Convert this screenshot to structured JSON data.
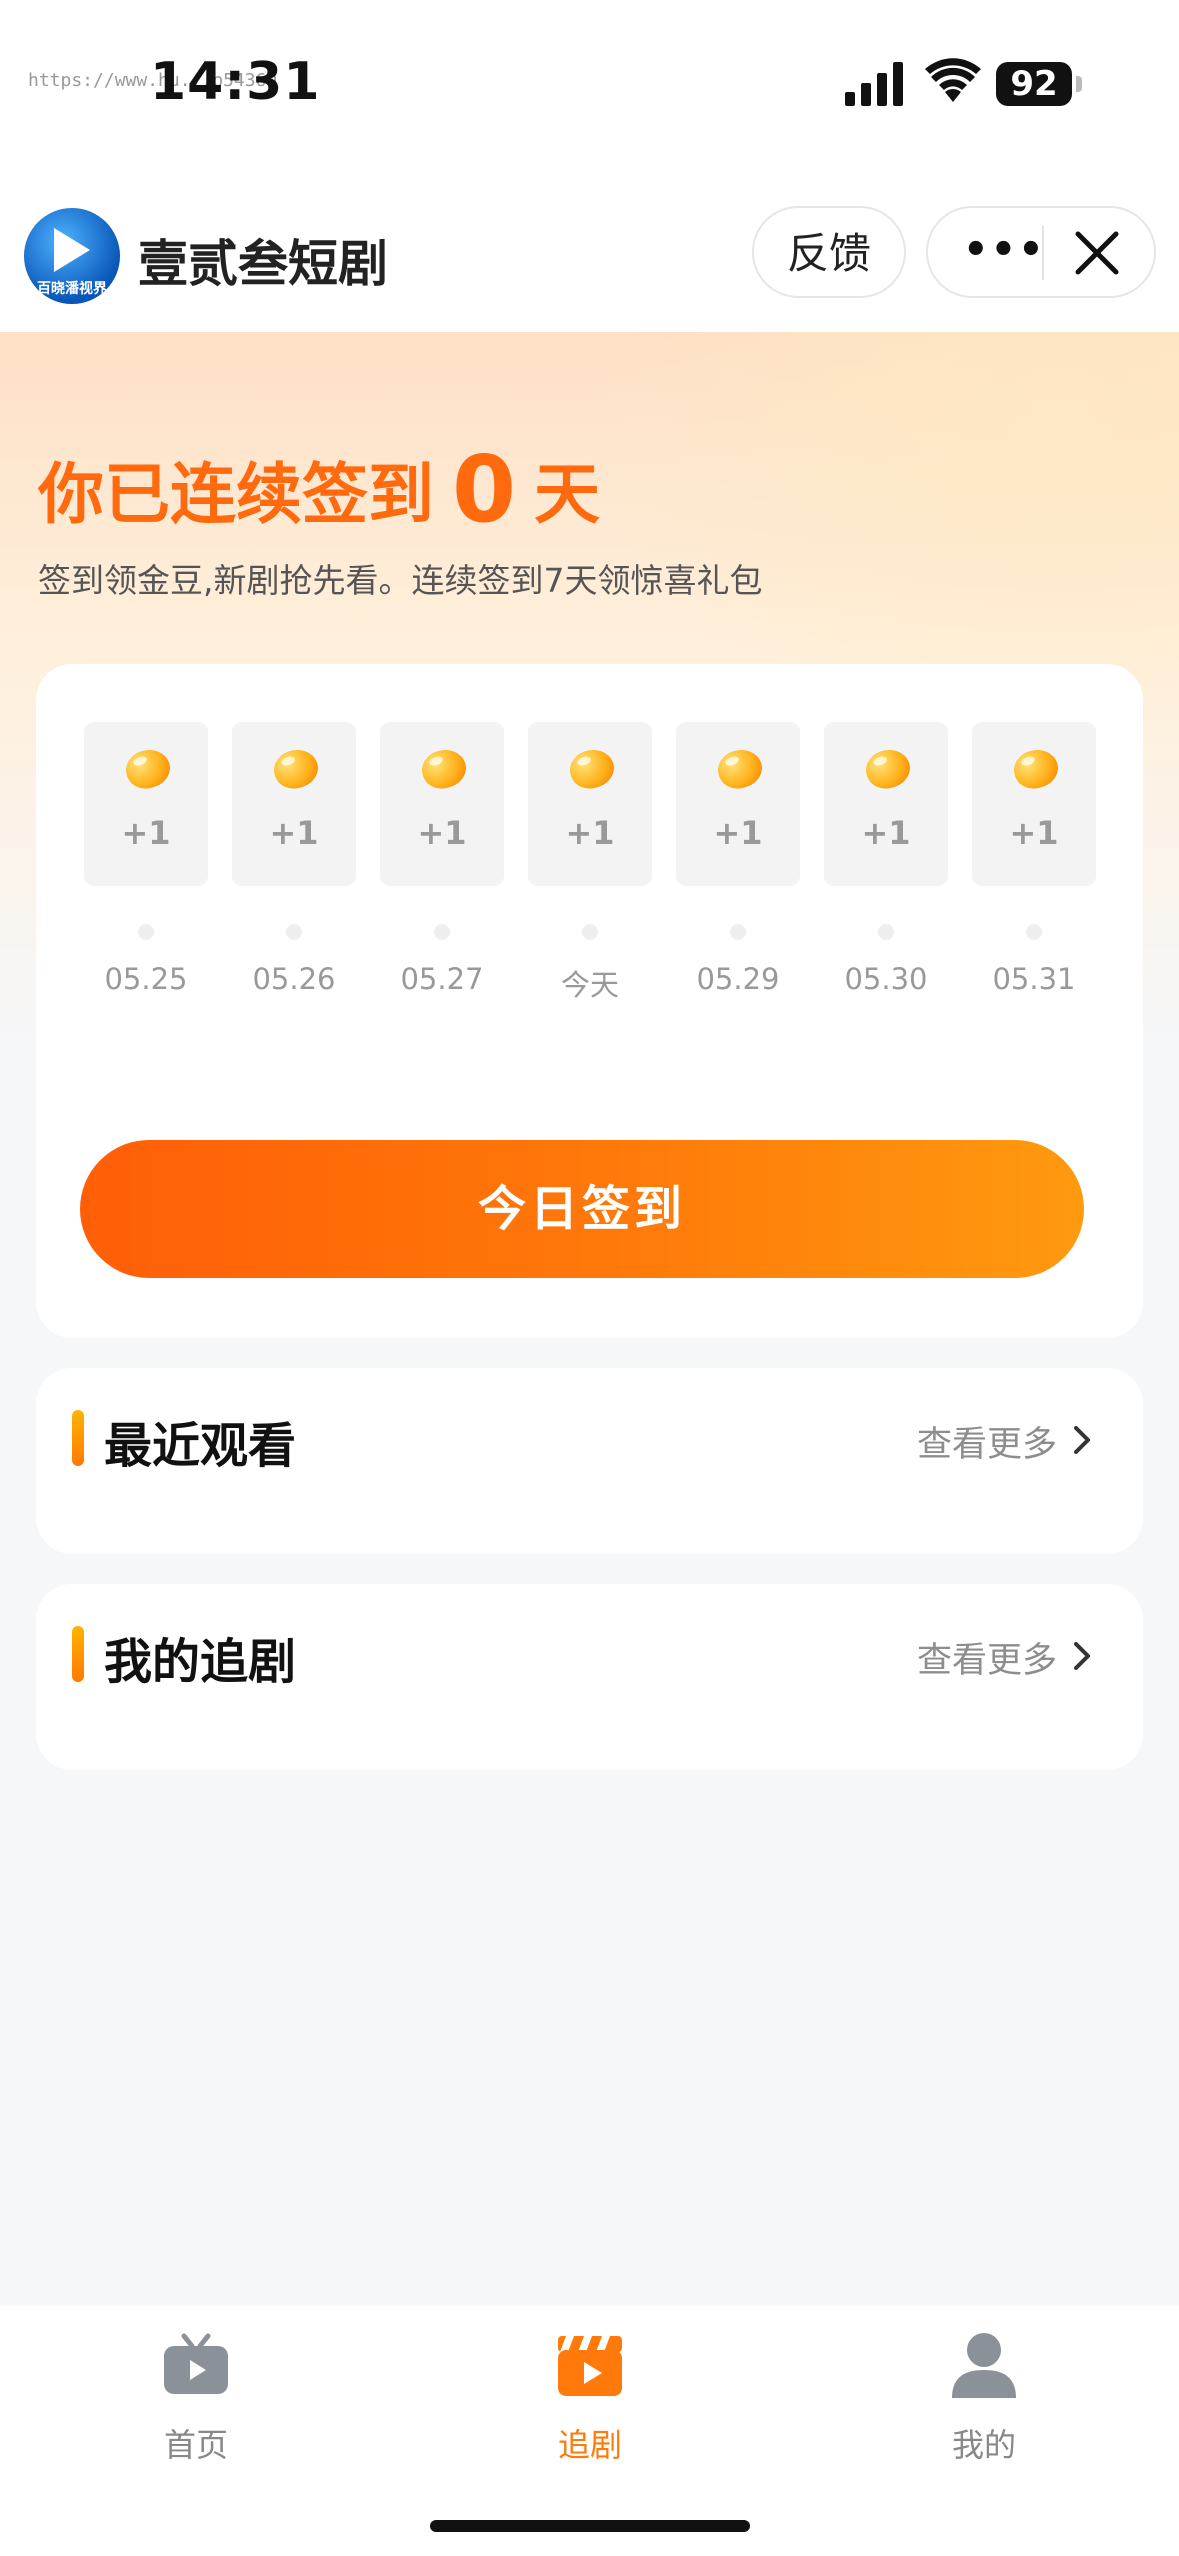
{
  "status_bar": {
    "time": "14:31",
    "watermark": "https://www.hu...b54360",
    "battery": "92"
  },
  "header": {
    "app_title": "壹贰叁短剧",
    "logo_text": "百晓潘视界",
    "feedback_label": "反馈",
    "more_label": "•••"
  },
  "hero": {
    "streak_prefix": "你已连续签到",
    "streak_days": "0",
    "streak_suffix": "天",
    "subtitle": "签到领金豆,新剧抢先看。连续签到7天领惊喜礼包"
  },
  "checkin": {
    "days": [
      {
        "reward": "+1",
        "date": "05.25"
      },
      {
        "reward": "+1",
        "date": "05.26"
      },
      {
        "reward": "+1",
        "date": "05.27"
      },
      {
        "reward": "+1",
        "date": "今天"
      },
      {
        "reward": "+1",
        "date": "05.29"
      },
      {
        "reward": "+1",
        "date": "05.30"
      },
      {
        "reward": "+1",
        "date": "05.31"
      }
    ],
    "button_label": "今日签到"
  },
  "sections": [
    {
      "title": "最近观看",
      "more_label": "查看更多"
    },
    {
      "title": "我的追剧",
      "more_label": "查看更多"
    }
  ],
  "tabbar": {
    "tabs": [
      {
        "label": "首页",
        "icon": "tv-icon",
        "active": false
      },
      {
        "label": "追剧",
        "icon": "clapperboard-icon",
        "active": true
      },
      {
        "label": "我的",
        "icon": "person-icon",
        "active": false
      }
    ]
  },
  "colors": {
    "accent": "#ff6a0e",
    "button_gradient_start": "#ff5e07",
    "button_gradient_end": "#ff9a0f",
    "tab_active": "#ff7a0a",
    "tab_inactive": "#8a9199"
  }
}
